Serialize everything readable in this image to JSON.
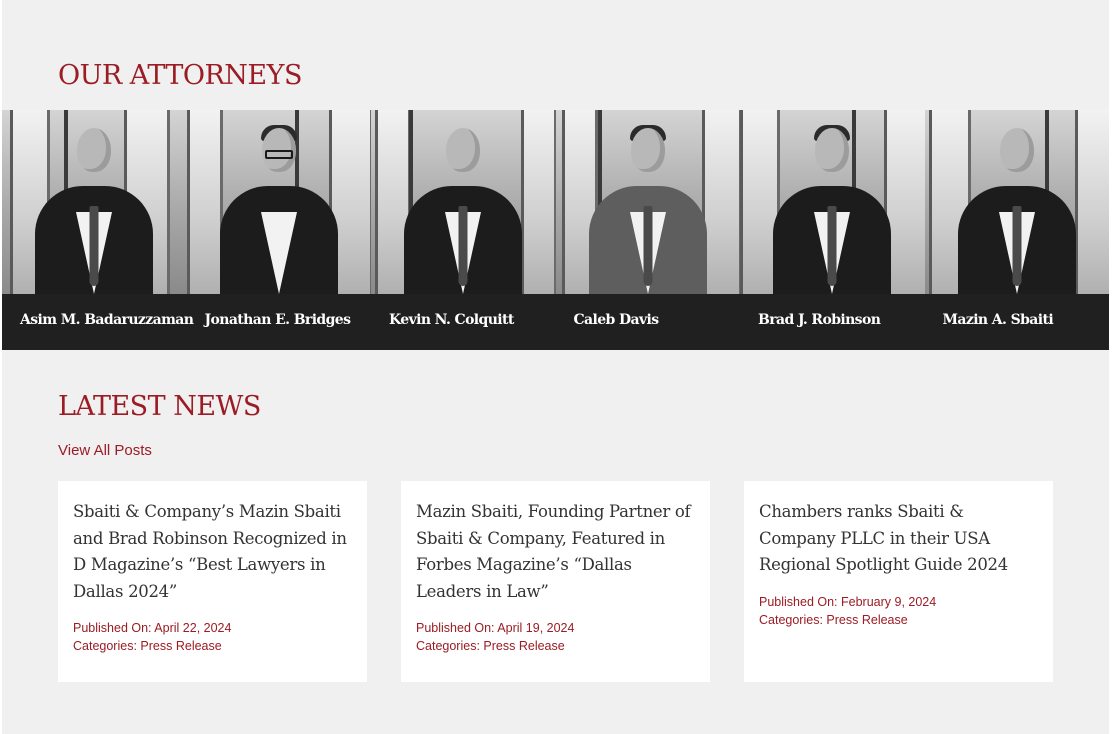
{
  "attorneys_section": {
    "title": "OUR ATTORNEYS",
    "attorneys": [
      {
        "name": "Asim M. Badaruzzaman"
      },
      {
        "name": "Jonathan E. Bridges"
      },
      {
        "name": "Kevin N. Colquitt"
      },
      {
        "name": "Caleb Davis"
      },
      {
        "name": "Brad J. Robinson"
      },
      {
        "name": "Mazin A. Sbaiti"
      }
    ]
  },
  "news_section": {
    "title": "LATEST NEWS",
    "view_all_label": "View All Posts",
    "posts": [
      {
        "title": "Sbaiti & Company’s Mazin Sbaiti and Brad Robinson Recognized in D Magazine’s “Best Lawyers in Dallas 2024”",
        "published": "Published On: April 22, 2024",
        "categories_label": "Categories:",
        "category": "Press Release"
      },
      {
        "title": "Mazin Sbaiti, Founding Partner of Sbaiti & Company, Featured in Forbes Magazine’s “Dallas Leaders in Law”",
        "published": "Published On: April 19, 2024",
        "categories_label": "Categories:",
        "category": "Press Release"
      },
      {
        "title": "Chambers ranks Sbaiti & Company PLLC in their USA Regional Spotlight Guide 2024",
        "published": "Published On: February 9, 2024",
        "categories_label": "Categories:",
        "category": "Press Release"
      }
    ]
  },
  "colors": {
    "accent": "#9b1c24",
    "background": "#f0f0f0",
    "name_bar": "#202021",
    "card": "#ffffff",
    "card_title": "#333333"
  }
}
